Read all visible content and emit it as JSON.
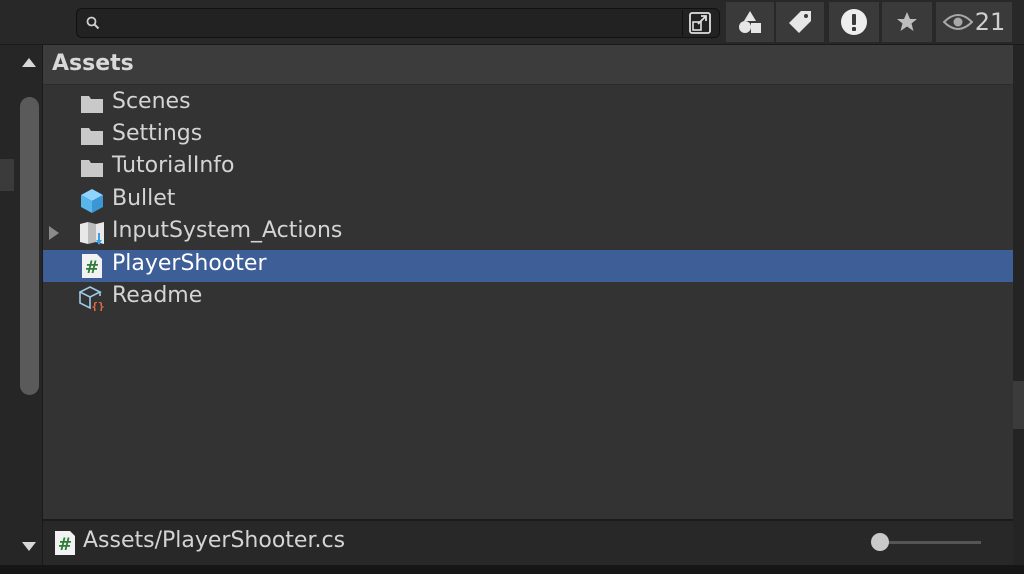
{
  "search": {
    "placeholder": ""
  },
  "toolbar": {
    "type_filter_icon": "shapes-icon",
    "label_filter_icon": "tag-icon",
    "errors_icon": "exclamation-icon",
    "favorites_icon": "star-icon",
    "visibility_count": "21"
  },
  "header": {
    "title": "Assets"
  },
  "items": [
    {
      "label": "Scenes",
      "icon": "folder-icon",
      "expandable": false,
      "selected": false
    },
    {
      "label": "Settings",
      "icon": "folder-icon",
      "expandable": false,
      "selected": false
    },
    {
      "label": "TutorialInfo",
      "icon": "folder-icon",
      "expandable": false,
      "selected": false
    },
    {
      "label": "Bullet",
      "icon": "prefab-cube-icon",
      "expandable": false,
      "selected": false
    },
    {
      "label": "InputSystem_Actions",
      "icon": "input-actions-icon",
      "expandable": true,
      "selected": false
    },
    {
      "label": "PlayerShooter",
      "icon": "csharp-script-icon",
      "expandable": false,
      "selected": true
    },
    {
      "label": "Readme",
      "icon": "scriptable-object-icon",
      "expandable": false,
      "selected": false
    }
  ],
  "footer": {
    "path": "Assets/PlayerShooter.cs",
    "icon": "csharp-script-icon",
    "zoom_level": 0.0
  },
  "colors": {
    "selection": "#3d5e96",
    "panel": "#333333",
    "header": "#3c3c3c",
    "folder": "#c9c9c9",
    "prefab": "#58b6ec"
  }
}
